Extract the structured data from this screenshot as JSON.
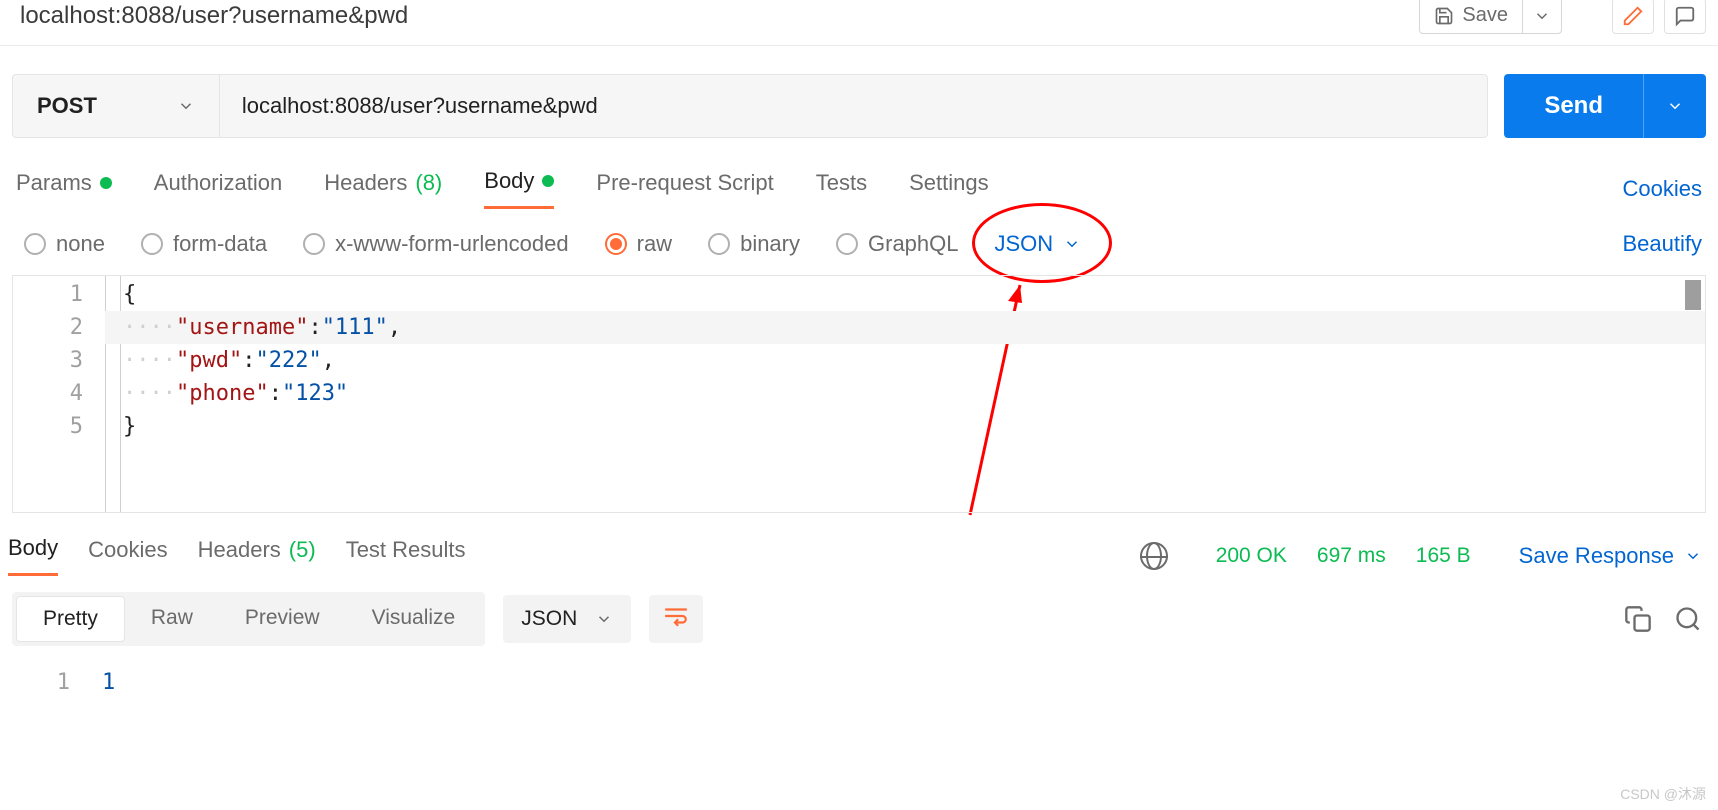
{
  "topbar": {
    "title": "localhost:8088/user?username&pwd",
    "save_label": "Save"
  },
  "request": {
    "method": "POST",
    "url": "localhost:8088/user?username&pwd",
    "send_label": "Send"
  },
  "tabs": {
    "params": "Params",
    "authorization": "Authorization",
    "headers": "Headers",
    "headers_count": "(8)",
    "body": "Body",
    "pre_request": "Pre-request Script",
    "tests": "Tests",
    "settings": "Settings",
    "cookies_link": "Cookies"
  },
  "body_types": {
    "none": "none",
    "form_data": "form-data",
    "x_www": "x-www-form-urlencoded",
    "raw": "raw",
    "binary": "binary",
    "graphql": "GraphQL",
    "content_type": "JSON",
    "beautify": "Beautify"
  },
  "editor": {
    "lines": [
      "1",
      "2",
      "3",
      "4",
      "5"
    ],
    "l1": "{",
    "l2_key": "\"username\"",
    "l2_val": "\"111\"",
    "l3_key": "\"pwd\"",
    "l3_val": "\"222\"",
    "l4_key": "\"phone\"",
    "l4_val": "\"123\"",
    "l5": "}"
  },
  "response_tabs": {
    "body": "Body",
    "cookies": "Cookies",
    "headers": "Headers",
    "headers_count": "(5)",
    "test_results": "Test Results",
    "status": "200 OK",
    "time": "697 ms",
    "size": "165 B",
    "save_response": "Save Response"
  },
  "response_modes": {
    "pretty": "Pretty",
    "raw": "Raw",
    "preview": "Preview",
    "visualize": "Visualize",
    "type": "JSON"
  },
  "response_body": {
    "line_num": "1",
    "value": "1"
  },
  "watermark": "CSDN @沐源"
}
